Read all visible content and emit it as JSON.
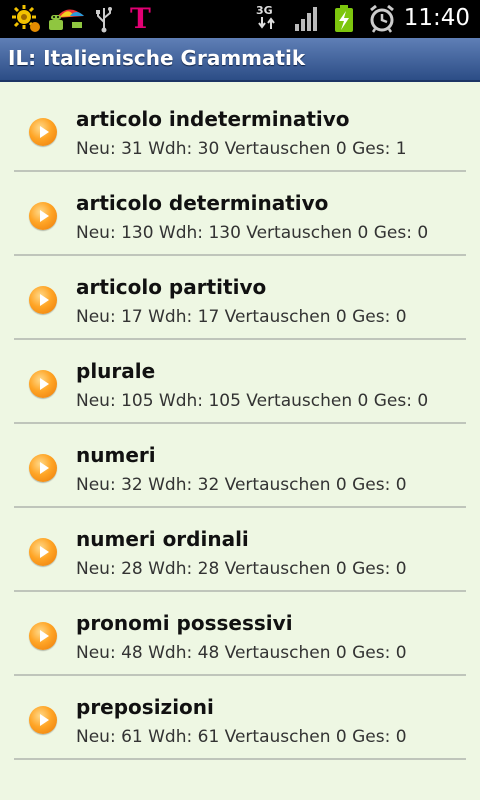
{
  "status_bar": {
    "time": "11:40",
    "network": "3G",
    "carrier_logo": "T",
    "icons": [
      "sun-settings-icon",
      "android-umbrella-icon",
      "usb-icon",
      "telekom-t-icon",
      "3g-icon",
      "signal-bars-icon",
      "battery-charging-icon",
      "alarm-clock-icon"
    ]
  },
  "titlebar": {
    "title": "IL: Italienische Grammatik"
  },
  "lessons": [
    {
      "title": "articolo indeterminativo",
      "stats": "Neu: 31 Wdh: 30 Vertauschen 0 Ges: 1"
    },
    {
      "title": "articolo determinativo",
      "stats": "Neu: 130 Wdh: 130 Vertauschen 0 Ges: 0"
    },
    {
      "title": "articolo partitivo",
      "stats": "Neu: 17 Wdh: 17 Vertauschen 0 Ges: 0"
    },
    {
      "title": "plurale",
      "stats": "Neu: 105 Wdh: 105 Vertauschen 0 Ges: 0"
    },
    {
      "title": "numeri",
      "stats": "Neu: 32 Wdh: 32 Vertauschen 0 Ges: 0"
    },
    {
      "title": "numeri ordinali",
      "stats": "Neu: 28 Wdh: 28 Vertauschen 0 Ges: 0"
    },
    {
      "title": "pronomi possessivi",
      "stats": "Neu: 48 Wdh: 48 Vertauschen 0 Ges: 0"
    },
    {
      "title": "preposizioni",
      "stats": "Neu: 61 Wdh: 61 Vertauschen 0 Ges: 0"
    }
  ],
  "colors": {
    "background": "#eef7e3",
    "titlebar": "#3d5f9a",
    "play_icon": "#ffa526"
  }
}
